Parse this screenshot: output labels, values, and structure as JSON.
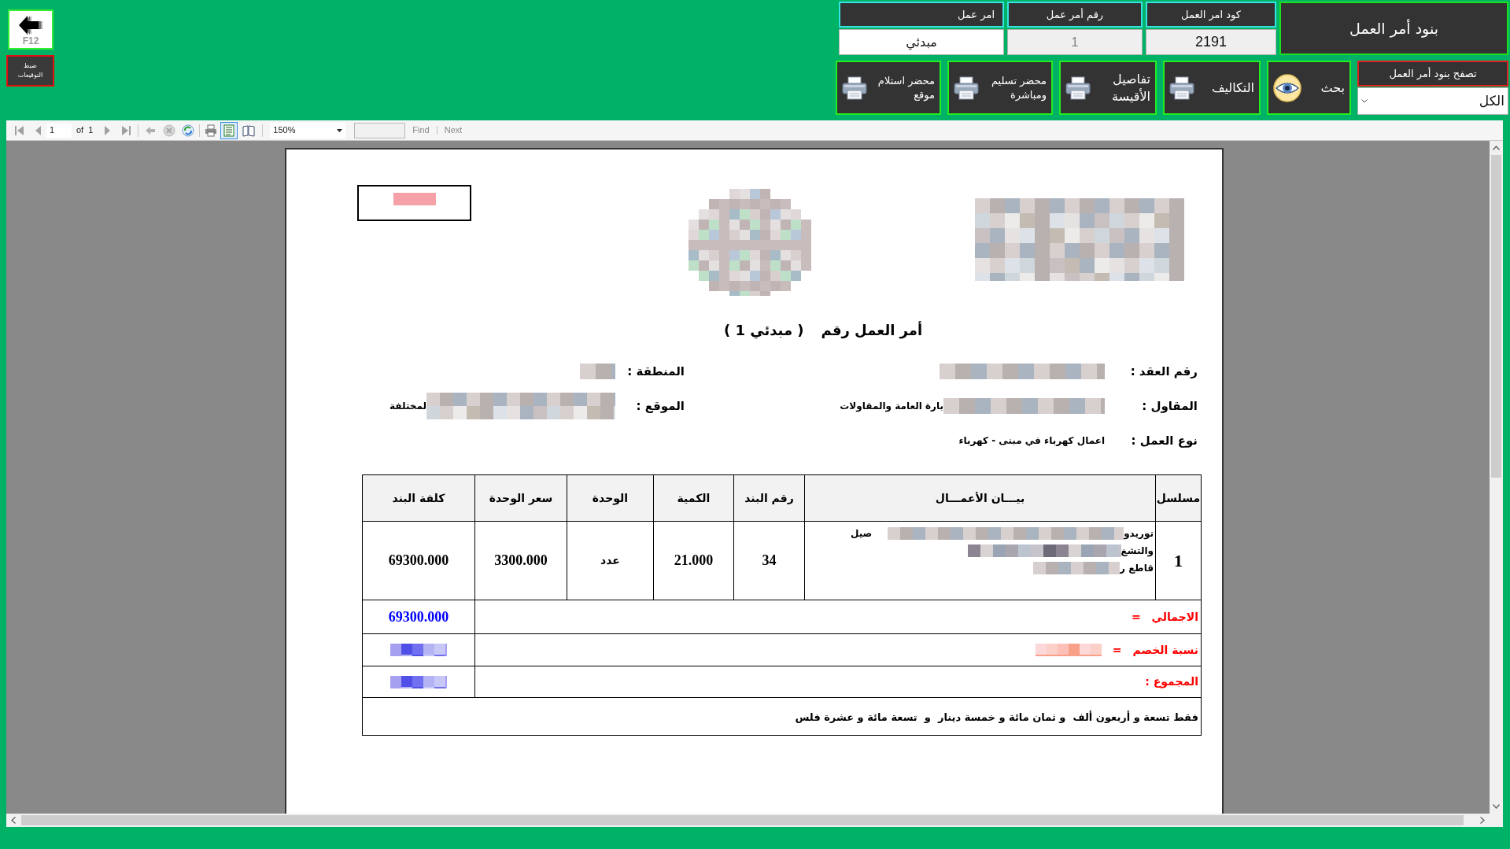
{
  "side": {
    "back_button": {
      "label": "F12"
    },
    "signatures_button": {
      "label": "ضبط التوقيعات"
    }
  },
  "header": {
    "title": "بنود أمر العمل",
    "fields": [
      {
        "label": "كود امر العمل",
        "value": "2191",
        "kind": "readonly"
      },
      {
        "label": "رقم أمر عمل",
        "value": "1",
        "kind": "disabled"
      },
      {
        "label": "امر عمل",
        "value": "مبدئي",
        "kind": "editable"
      }
    ]
  },
  "browse": {
    "label": "تصفح بنود أمر العمل",
    "value": "الكل"
  },
  "actions": [
    {
      "label": "بحث",
      "kind": "search"
    },
    {
      "label": "التكاليف",
      "kind": "print"
    },
    {
      "label": "تفاصيل الأقيسة",
      "kind": "print"
    },
    {
      "label": "محضر تسليم ومباشرة",
      "kind": "print"
    },
    {
      "label": "محضر استلام موقع",
      "kind": "print"
    }
  ],
  "toolbar": {
    "page": "1",
    "of_label": "of",
    "page_count": "1",
    "zoom": "150%",
    "find_label": "Find",
    "next_label": "Next",
    "print_layout_selected": true
  },
  "report": {
    "title": "أمر العمل رقم",
    "title_value": "( مبدئي 1 )",
    "info": [
      {
        "label": "رقم العقد :",
        "redacted": true
      },
      {
        "label": "المنطقة :",
        "redacted": true
      },
      {
        "label": "المقاول :",
        "value": "بارة العامة والمقاولات",
        "redacted": true
      },
      {
        "label": "الموقع :",
        "value": "لمختلفة",
        "redacted": true
      },
      {
        "label": "نوع العمل :",
        "value": "اعمال كهرباء في مبنى - كهرباء",
        "redacted": false
      }
    ],
    "table": {
      "columns": [
        "مسلسل",
        "بيـــان الأعمـــال",
        "رقم البند",
        "الكمية",
        "الوحدة",
        "سعر الوحدة",
        "كلفة البند"
      ],
      "rows": [
        {
          "serial": "1",
          "description_lines": [
            "توريدو",
            "والتشغ",
            "قاطع ر"
          ],
          "description_tail": "صيل",
          "description_redacted": true,
          "item_no": "34",
          "quantity": "21.000",
          "unit": "عدد",
          "unit_price": "3300.000",
          "cost": "69300.000"
        }
      ]
    },
    "totals": [
      {
        "label": "الاجمالي",
        "sign": "=",
        "value": "69300.000",
        "redacted": false,
        "note_redacted": false
      },
      {
        "label": "نسبة الخصم",
        "sign": "=",
        "redacted": true,
        "note_redacted": true
      },
      {
        "label": "المجموع :",
        "redacted": true,
        "note_redacted": false
      }
    ],
    "amount_in_words": "فقط تسعة و أربعون ألف  و ثمان مائة و خمسة دينار  و  تسعة مائة و عشرة فلس"
  }
}
